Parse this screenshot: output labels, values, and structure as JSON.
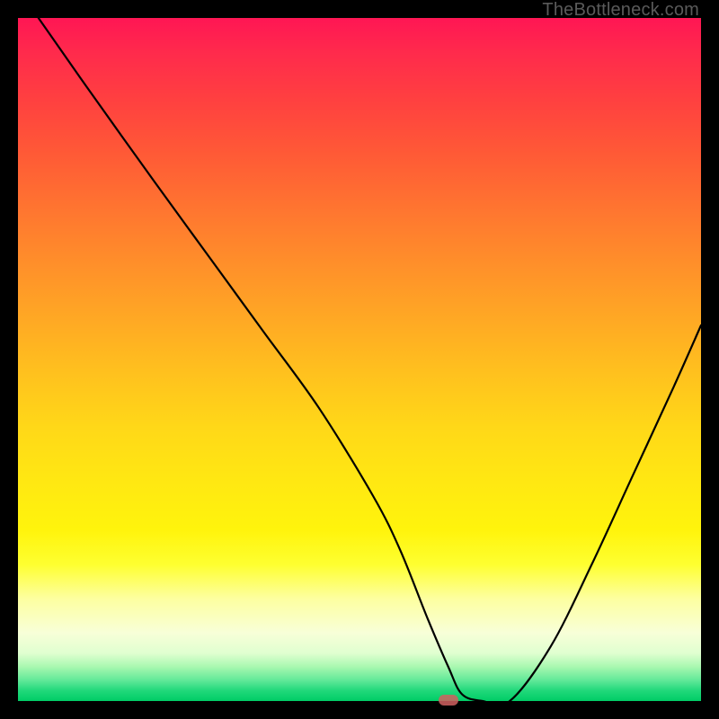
{
  "watermark": "TheBottleneck.com",
  "chart_data": {
    "type": "line",
    "title": "",
    "xlabel": "",
    "ylabel": "",
    "xlim": [
      0,
      100
    ],
    "ylim": [
      0,
      100
    ],
    "grid": false,
    "background": "rainbow-vertical-red-to-green",
    "series": [
      {
        "name": "bottleneck-curve",
        "color": "#000000",
        "x": [
          3,
          10,
          20,
          28,
          36,
          44,
          52,
          56,
          60,
          63,
          65,
          68,
          72,
          78,
          84,
          90,
          96,
          100
        ],
        "y": [
          100,
          90,
          76,
          65,
          54,
          43,
          30,
          22,
          12,
          5,
          1,
          0,
          0,
          8,
          20,
          33,
          46,
          55
        ]
      }
    ],
    "minimum_point": {
      "x_percent": 63,
      "y_percent": 0
    },
    "marker": {
      "x_percent": 63,
      "y_percent": 0,
      "color": "#d06060",
      "shape": "rounded-rect"
    }
  }
}
